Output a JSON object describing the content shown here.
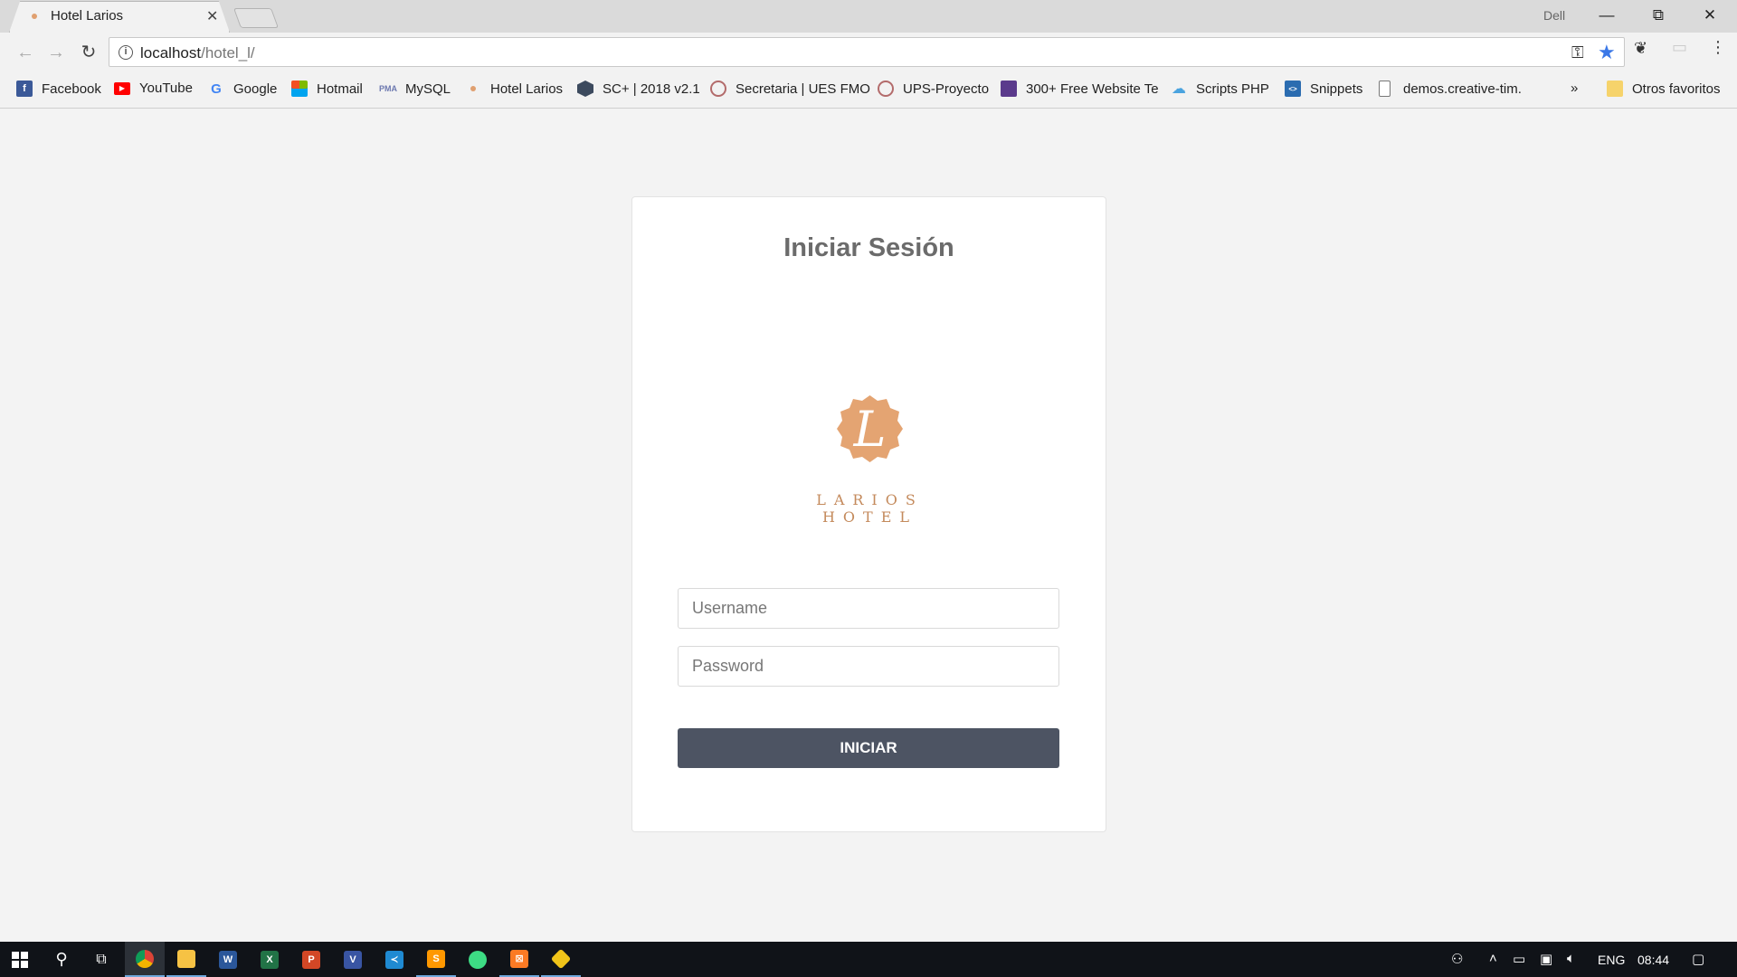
{
  "browser": {
    "tab_title": "Hotel Larios",
    "profile": "Dell",
    "url_host": "localhost",
    "url_path": "/hotel_l/"
  },
  "bookmarks": [
    {
      "label": "Facebook",
      "icon": "facebook-icon",
      "color": "#3b5998",
      "glyph": "f"
    },
    {
      "label": "YouTube",
      "icon": "youtube-icon",
      "color": "#ff0000",
      "glyph": "▶"
    },
    {
      "label": "Google",
      "icon": "google-icon",
      "color": "#4285f4",
      "glyph": "G"
    },
    {
      "label": "Hotmail",
      "icon": "microsoft-icon",
      "color": "#f25022",
      "glyph": ""
    },
    {
      "label": "MySQL",
      "icon": "phpmyadmin-icon",
      "color": "#6c78af",
      "glyph": ""
    },
    {
      "label": "Hotel Larios",
      "icon": "larios-icon",
      "color": "#e0a070",
      "glyph": ""
    },
    {
      "label": "SC+ | 2018 v2.1",
      "icon": "hexagon-icon",
      "color": "#3c4a5e",
      "glyph": ""
    },
    {
      "label": "Secretaria | UES FMO",
      "icon": "ues-icon",
      "color": "#b36b6b",
      "glyph": ""
    },
    {
      "label": "UPS-Proyecto",
      "icon": "ues-icon",
      "color": "#b36b6b",
      "glyph": ""
    },
    {
      "label": "300+ Free Website Te",
      "icon": "colorlib-icon",
      "color": "#5b3a8c",
      "glyph": ""
    },
    {
      "label": "Scripts PHP",
      "icon": "cloud-icon",
      "color": "#4aa3df",
      "glyph": ""
    },
    {
      "label": "Snippets",
      "icon": "code-icon",
      "color": "#2b6cb0",
      "glyph": "<>"
    },
    {
      "label": "demos.creative-tim.",
      "icon": "page-icon",
      "color": "#ffffff",
      "glyph": ""
    }
  ],
  "bookmarks_more": "»",
  "other_bookmarks": "Otros favoritos",
  "login": {
    "title": "Iniciar Sesión",
    "logo_text": "LARIOS HOTEL",
    "logo_letter": "L",
    "username_placeholder": "Username",
    "password_placeholder": "Password",
    "submit_label": "INICIAR",
    "accent": "#e4a472",
    "button_color": "#4d5463"
  },
  "taskbar": {
    "language": "ENG",
    "time": "08:44"
  }
}
